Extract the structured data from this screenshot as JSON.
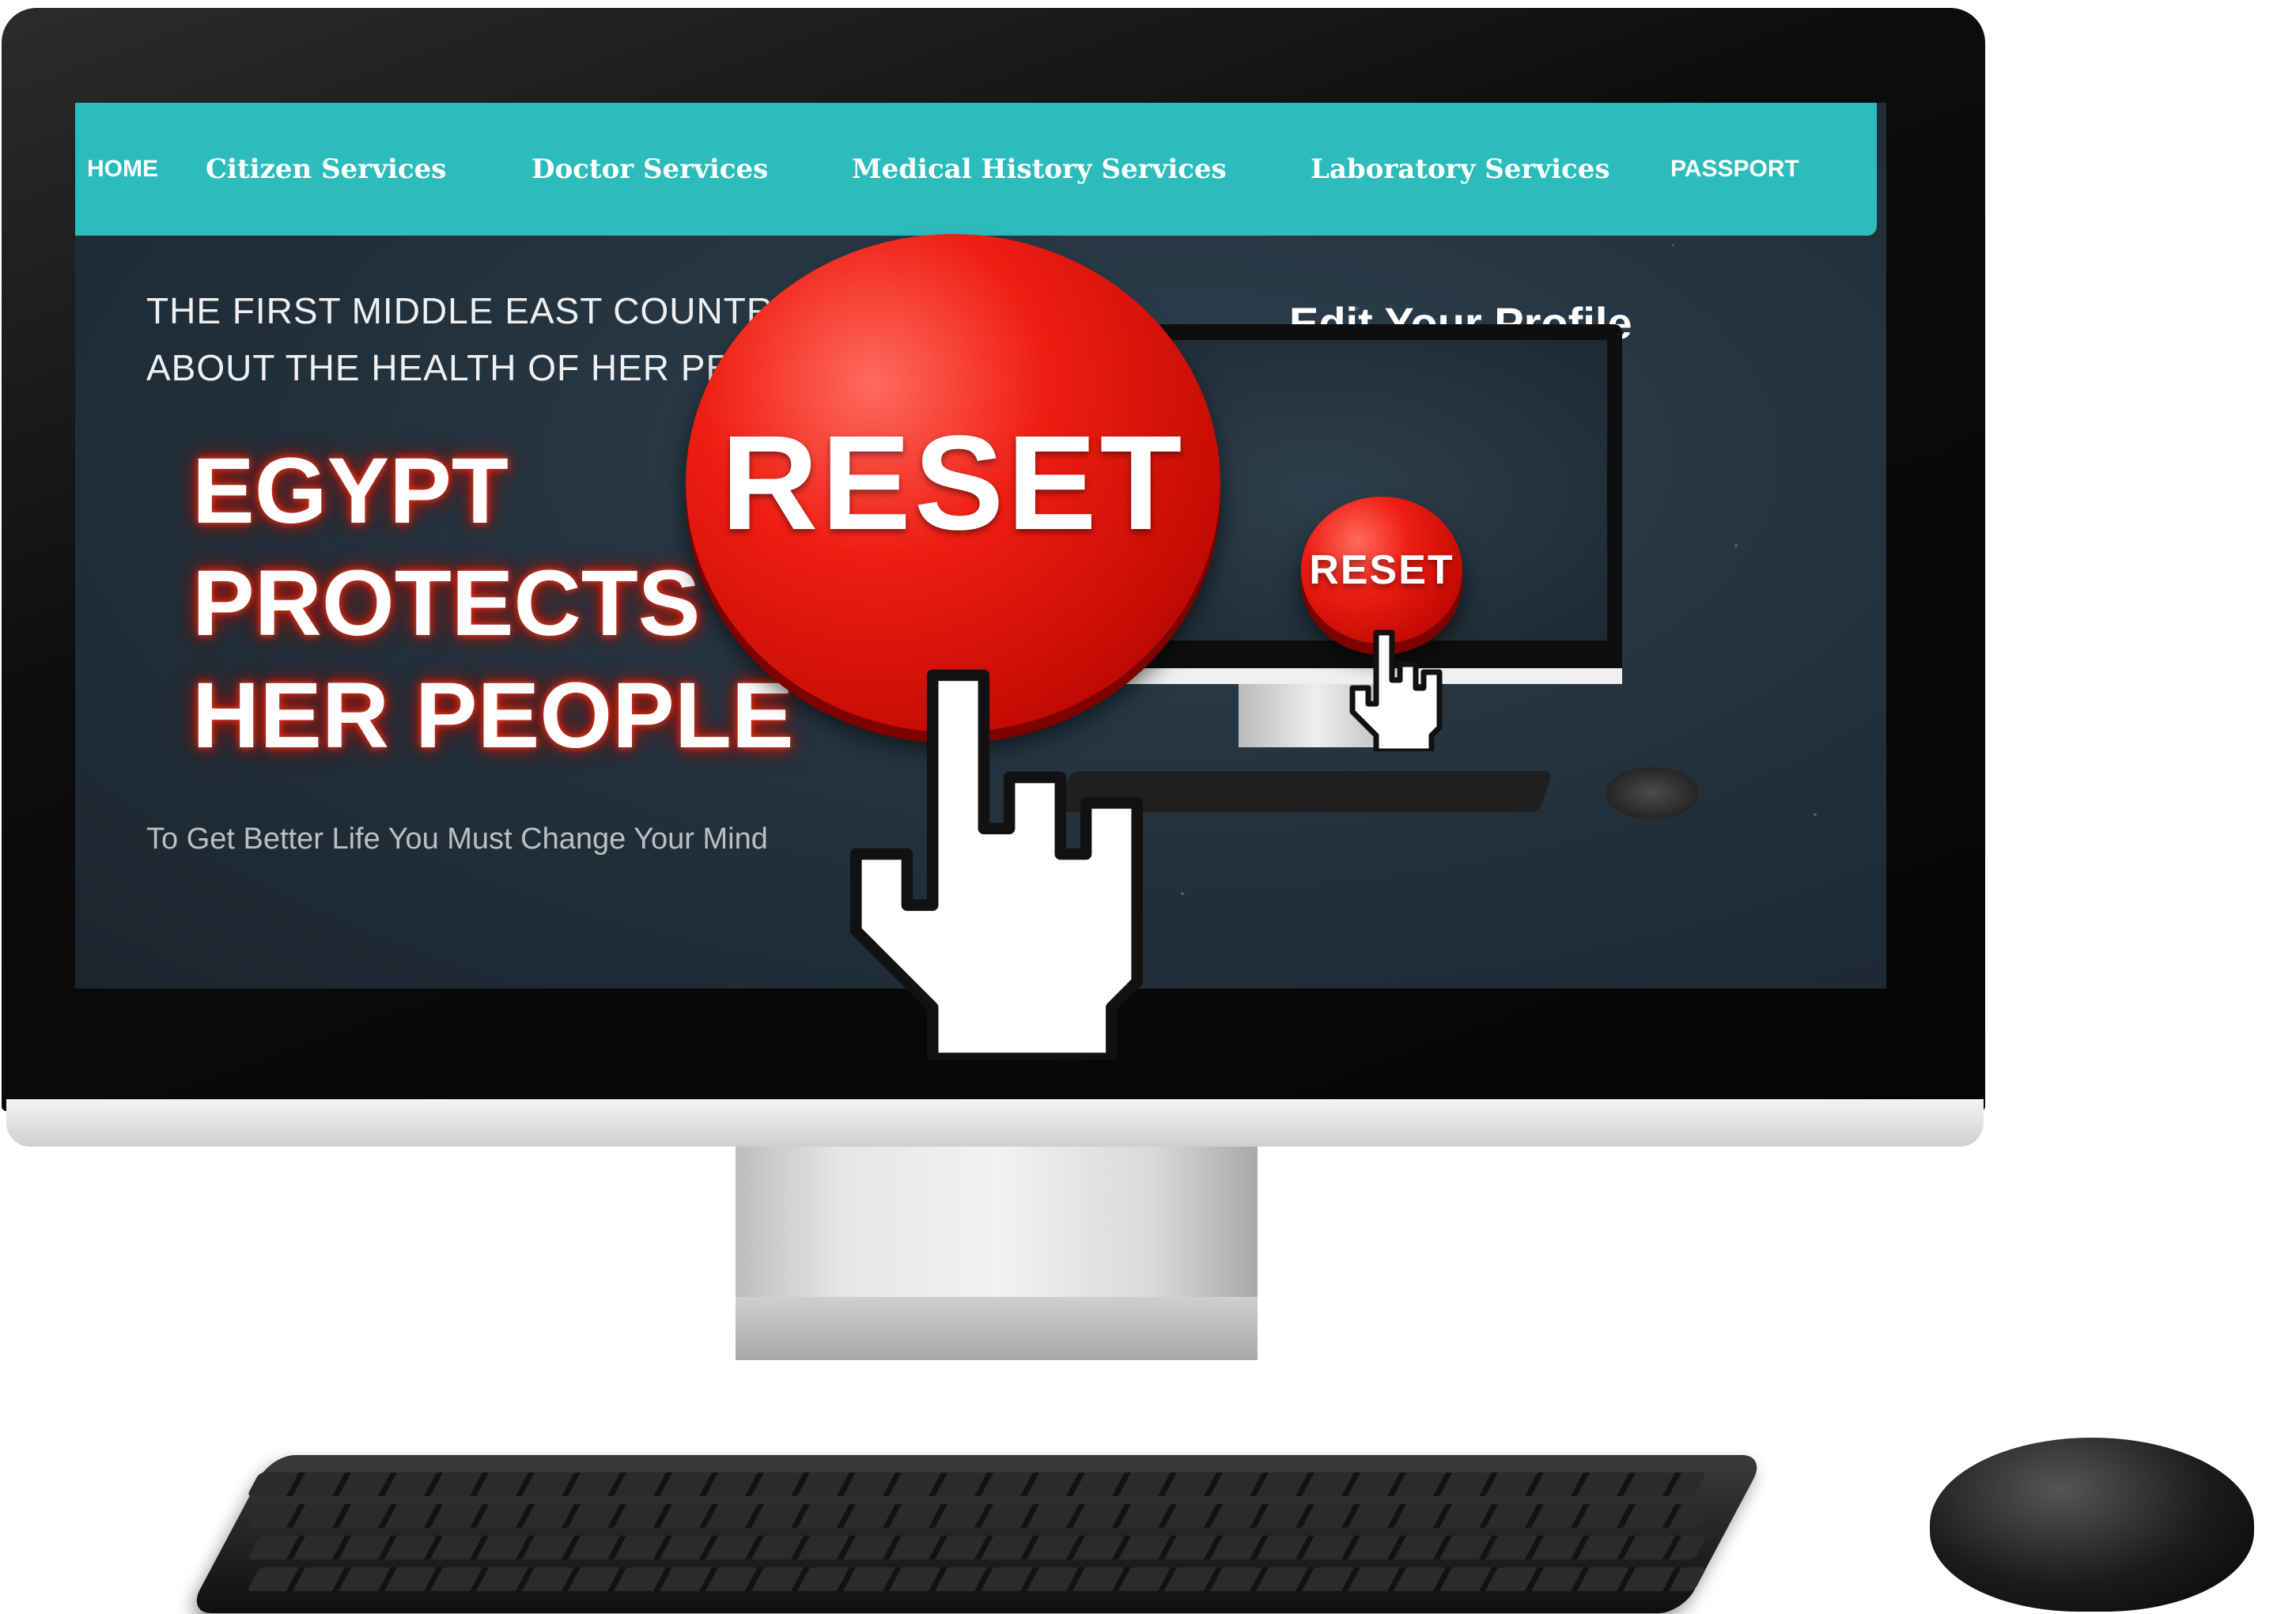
{
  "nav": {
    "items": [
      {
        "label": "HOME"
      },
      {
        "label": "Citizen Services"
      },
      {
        "label": "Doctor Services"
      },
      {
        "label": "Medical History Services"
      },
      {
        "label": "Laboratory Services"
      },
      {
        "label": "PASSPORT"
      }
    ]
  },
  "hero": {
    "line1": "THE FIRST MIDDLE EAST COUNTRY CA",
    "line2": "ABOUT THE HEALTH OF HER PEOPL",
    "slogan": [
      "EGYPT",
      "PROTECTS",
      "HER PEOPLE"
    ],
    "tagline": "To Get Better Life You Must Change Your Mind"
  },
  "profile": {
    "title": "Edit Your Profile"
  },
  "reset_button": {
    "label": "RESET",
    "color": "#e5170c"
  },
  "colors": {
    "navbar": "#2cbcbc",
    "screen_bg": "#22303b",
    "slogan_glow": "#d42a12"
  },
  "icons": [
    "pointing-hand-cursor-icon"
  ]
}
